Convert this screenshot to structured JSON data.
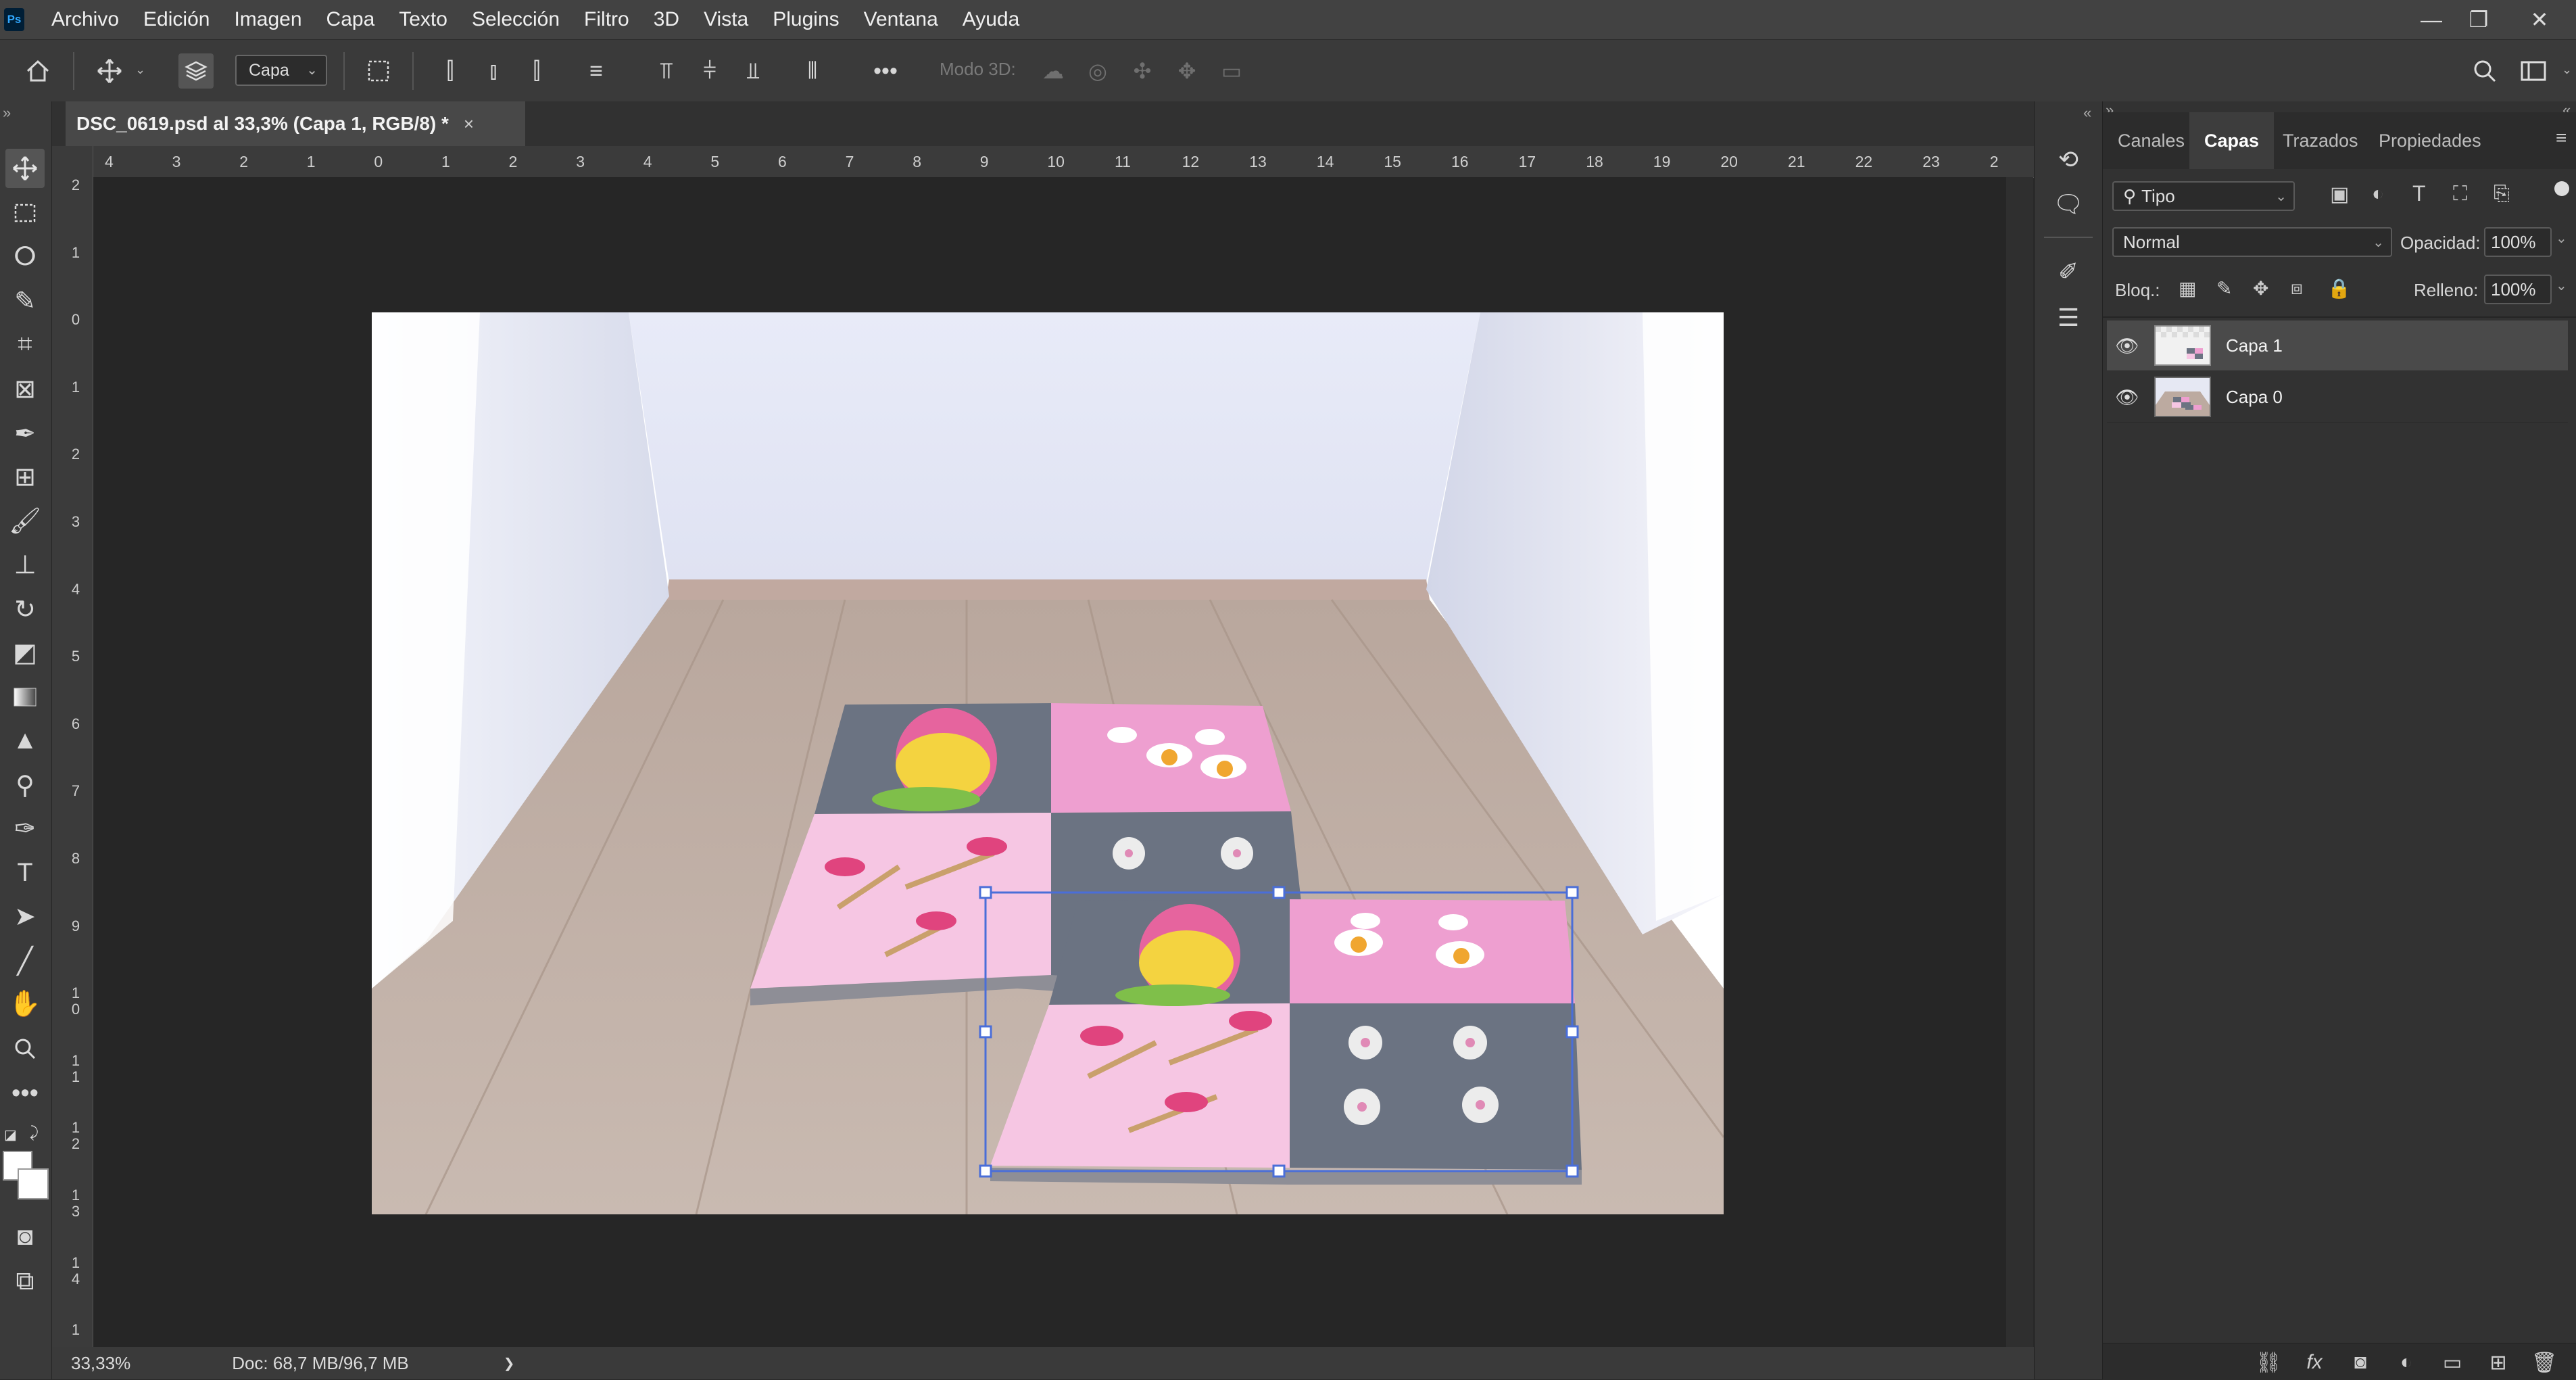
{
  "app": {
    "logo": "Ps"
  },
  "menu": [
    "Archivo",
    "Edición",
    "Imagen",
    "Capa",
    "Texto",
    "Selección",
    "Filtro",
    "3D",
    "Vista",
    "Plugins",
    "Ventana",
    "Ayuda"
  ],
  "window_controls": {
    "minimize": "—",
    "restore": "❐",
    "close": "✕"
  },
  "options_bar": {
    "target_select": "Capa",
    "mode3d_label": "Modo 3D:"
  },
  "document": {
    "tab_title": "DSC_0619.psd al 33,3% (Capa 1, RGB/8) *",
    "close_glyph": "×"
  },
  "rulers": {
    "top": [
      "4",
      "3",
      "2",
      "1",
      "0",
      "1",
      "2",
      "3",
      "4",
      "5",
      "6",
      "7",
      "8",
      "9",
      "10",
      "11",
      "12",
      "13",
      "14",
      "15",
      "16",
      "17",
      "18",
      "19",
      "20",
      "21",
      "22",
      "23",
      "2"
    ],
    "left": [
      "2",
      "1",
      "0",
      "1",
      "2",
      "3",
      "4",
      "5",
      "6",
      "7",
      "8",
      "9",
      "1 0",
      "1 1",
      "1 2",
      "1 3",
      "1 4",
      "1"
    ]
  },
  "status": {
    "zoom": "33,33%",
    "doc_size": "Doc: 68,7 MB/96,7 MB",
    "arrow": "❯"
  },
  "panel": {
    "tabs": [
      "Canales",
      "Capas",
      "Trazados",
      "Propiedades"
    ],
    "active_tab": "Capas",
    "filter_kind": "Tipo",
    "blend_mode": "Normal",
    "opacity_label": "Opacidad:",
    "opacity_value": "100%",
    "lock_label": "Bloq.:",
    "fill_label": "Relleno:",
    "fill_value": "100%",
    "layers": [
      {
        "name": "Capa 1",
        "selected": true
      },
      {
        "name": "Capa 0",
        "selected": false
      }
    ]
  },
  "colors": {
    "menubar_bg": "#424242",
    "canvas_bg": "#262626",
    "selection_accent": "#4a6ed8",
    "mat_pink": "#f0a6d3",
    "mat_light_pink": "#f5c7e2",
    "mat_grey": "#68707e"
  },
  "icons": {
    "toolbar": [
      "move-icon",
      "marquee-icon",
      "lasso-icon",
      "quick-select-icon",
      "crop-icon",
      "frame-icon",
      "eyedropper-icon",
      "patch-icon",
      "brush-icon",
      "stamp-icon",
      "history-brush-icon",
      "eraser-icon",
      "gradient-icon",
      "blur-icon",
      "dodge-icon",
      "pen-icon",
      "type-icon",
      "path-select-icon",
      "line-icon",
      "hand-icon",
      "zoom-icon",
      "more-tools-icon"
    ]
  }
}
